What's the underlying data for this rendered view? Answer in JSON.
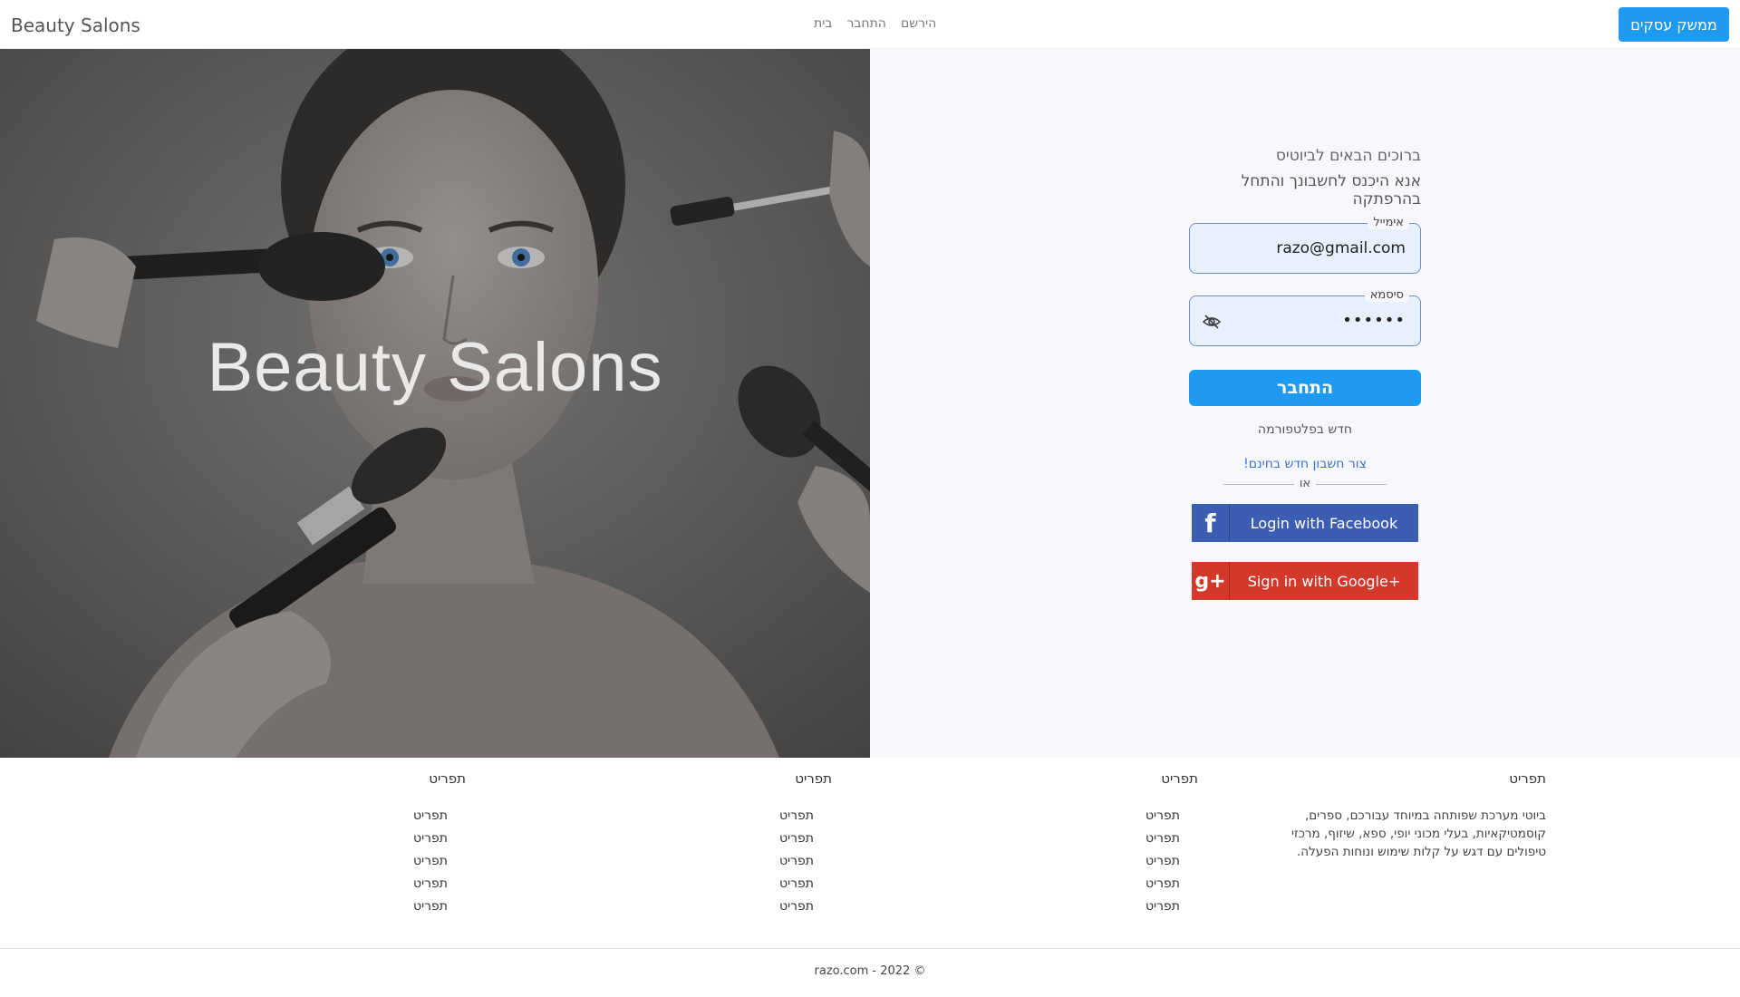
{
  "navbar": {
    "brand": "Beauty Salons",
    "links": [
      "בית",
      "התחבר",
      "הירשם"
    ],
    "business_button": "ממשק עסקים"
  },
  "hero": {
    "title": "Beauty Salons"
  },
  "login": {
    "welcome": "ברוכים הבאים לביוטיס",
    "prompt": "אנא היכנס לחשבונך והתחל בהרפתקה",
    "email_label": "אימייל",
    "email_value": "razo@gmail.com",
    "password_label": "סיסמא",
    "password_value": "••••••",
    "password_toggle_icon": "eye-slash-icon",
    "submit": "התחבר",
    "new_text": "חדש בפלטפורמה",
    "create_link": "צור חשבון חדש בחינם!",
    "or": "או",
    "facebook": "Login with Facebook",
    "google": "Sign in with Google+"
  },
  "footer": {
    "columns": [
      {
        "title": "תפריט",
        "description": "ביוטי מערכת שפותחה במיוחד עבורכם, ספרים, קוסמטיקאיות, בעלי מכוני יופי, ספא, שיזוף, מרכזי טיפולים עם דגש על קלות שימוש ונוחות הפעלה."
      },
      {
        "title": "תפריט",
        "links": [
          "תפריט",
          "תפריט",
          "תפריט",
          "תפריט",
          "תפריט"
        ]
      },
      {
        "title": "תפריט",
        "links": [
          "תפריט",
          "תפריט",
          "תפריט",
          "תפריט",
          "תפריט"
        ]
      },
      {
        "title": "תפריט",
        "links": [
          "תפריט",
          "תפריט",
          "תפריט",
          "תפריט",
          "תפריט"
        ]
      }
    ],
    "copyright": "razo.com - 2022 ©"
  },
  "colors": {
    "accent": "#1e9bf0",
    "facebook": "#3b5eb3",
    "google": "#d3392b",
    "link": "#3b6fd8"
  }
}
